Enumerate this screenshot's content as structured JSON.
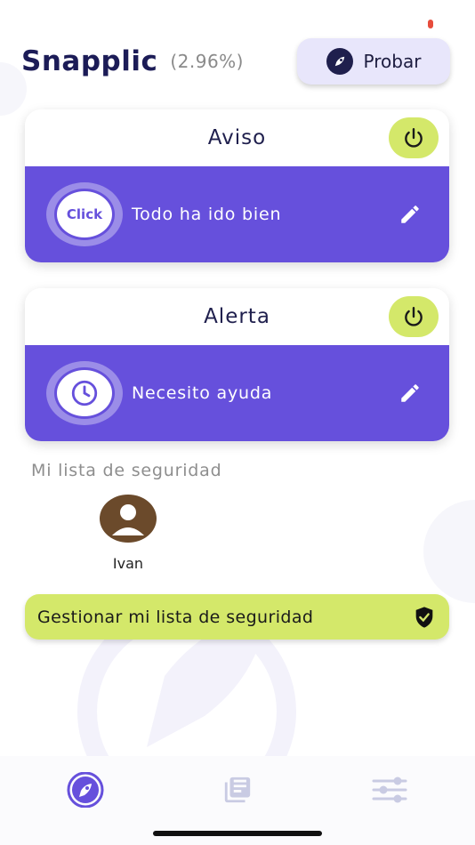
{
  "header": {
    "title": "Snapplic",
    "percent": "(2.96%)",
    "try_label": "Probar"
  },
  "cards": [
    {
      "title": "Aviso",
      "message": "Todo ha ido bien",
      "badge": "Click"
    },
    {
      "title": "Alerta",
      "message": "Necesito ayuda"
    }
  ],
  "safety": {
    "section_label": "Mi lista de seguridad",
    "contacts": [
      {
        "name": "Ivan"
      }
    ],
    "manage_label": "Gestionar mi lista de seguridad"
  },
  "nav": {
    "items": [
      "rocket-icon",
      "news-icon",
      "settings-sliders-icon"
    ],
    "active": 0
  },
  "colors": {
    "primary": "#6650dc",
    "accent": "#d4e86a",
    "title": "#1c1c57",
    "avatar_bg": "#6b4a2b"
  }
}
